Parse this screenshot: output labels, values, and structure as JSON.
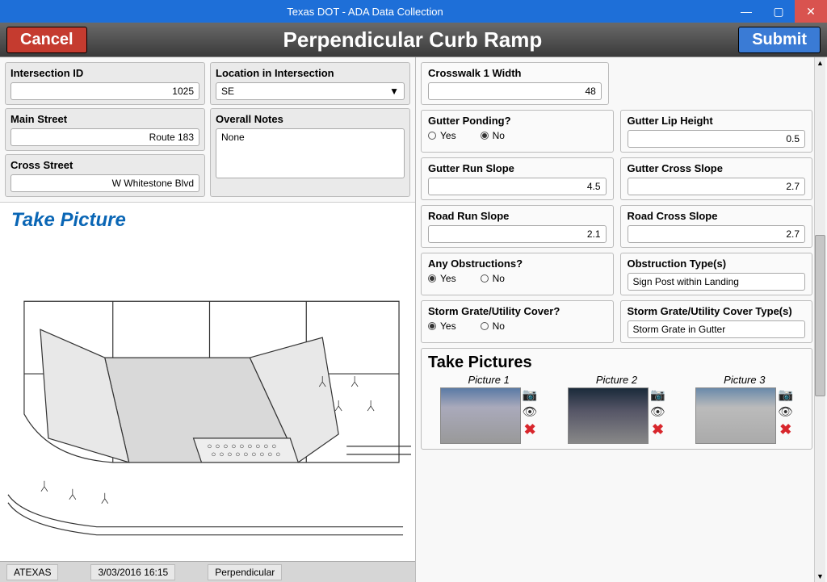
{
  "window": {
    "title": "Texas DOT - ADA Data Collection"
  },
  "header": {
    "cancel": "Cancel",
    "title": "Perpendicular Curb Ramp",
    "submit": "Submit"
  },
  "left": {
    "intersection_id": {
      "label": "Intersection ID",
      "value": "1025"
    },
    "main_street": {
      "label": "Main Street",
      "value": "Route 183"
    },
    "cross_street": {
      "label": "Cross Street",
      "value": "W Whitestone Blvd"
    },
    "location": {
      "label": "Location in Intersection",
      "value": "SE"
    },
    "notes": {
      "label": "Overall Notes",
      "value": "None"
    },
    "take_picture": "Take Picture"
  },
  "status": {
    "user": "ATEXAS",
    "datetime": "3/03/2016 16:15",
    "type": "Perpendicular"
  },
  "right": {
    "crosswalk1_width": {
      "label": "Crosswalk 1 Width",
      "value": "48"
    },
    "gutter_ponding": {
      "label": "Gutter Ponding?",
      "yes": "Yes",
      "no": "No",
      "selected": "No"
    },
    "gutter_lip_height": {
      "label": "Gutter Lip Height",
      "value": "0.5"
    },
    "gutter_run_slope": {
      "label": "Gutter Run Slope",
      "value": "4.5"
    },
    "gutter_cross_slope": {
      "label": "Gutter Cross Slope",
      "value": "2.7"
    },
    "road_run_slope": {
      "label": "Road Run Slope",
      "value": "2.1"
    },
    "road_cross_slope": {
      "label": "Road Cross Slope",
      "value": "2.7"
    },
    "obstructions": {
      "label": "Any Obstructions?",
      "yes": "Yes",
      "no": "No",
      "selected": "Yes"
    },
    "obstruction_types": {
      "label": "Obstruction Type(s)",
      "value": "Sign Post within Landing"
    },
    "storm_grate": {
      "label": "Storm Grate/Utility Cover?",
      "yes": "Yes",
      "no": "No",
      "selected": "Yes"
    },
    "storm_grate_types": {
      "label": "Storm Grate/Utility Cover Type(s)",
      "value": "Storm Grate in Gutter"
    },
    "pictures": {
      "title": "Take Pictures",
      "p1": "Picture 1",
      "p2": "Picture 2",
      "p3": "Picture 3"
    }
  }
}
